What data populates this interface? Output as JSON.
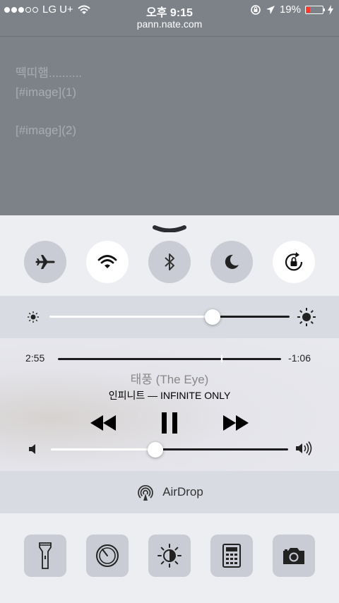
{
  "status_bar": {
    "carrier": "LG U+",
    "time": "오후 9:15",
    "battery": "19%",
    "battery_level": 0.19,
    "signal_bars": 3
  },
  "browser": {
    "url": "pann.nate.com",
    "lines": [
      "떽띠햄..........",
      "[#image](1)",
      "",
      "[#image](2)"
    ]
  },
  "control_center": {
    "toggles": [
      {
        "icon": "airplane-icon",
        "active": false
      },
      {
        "icon": "wifi-icon",
        "active": true
      },
      {
        "icon": "bluetooth-icon",
        "active": false
      },
      {
        "icon": "moon-icon",
        "active": false
      },
      {
        "icon": "rotation-lock-icon",
        "active": true
      }
    ],
    "brightness_level": 0.68,
    "music": {
      "elapsed": "2:55",
      "remaining": "-1:06",
      "progress": 0.73,
      "title": "태풍 (The Eye)",
      "artist_album": "인피니트 — INFINITE ONLY",
      "volume_level": 0.44
    },
    "airdrop_label": "AirDrop",
    "shortcuts": [
      "flashlight-icon",
      "timer-icon",
      "night-shift-icon",
      "calculator-icon",
      "camera-icon"
    ],
    "colors": {
      "active_toggle": "#ffffff",
      "inactive_toggle": "#c9ccd4",
      "battery_low": "#ff3b30"
    }
  }
}
